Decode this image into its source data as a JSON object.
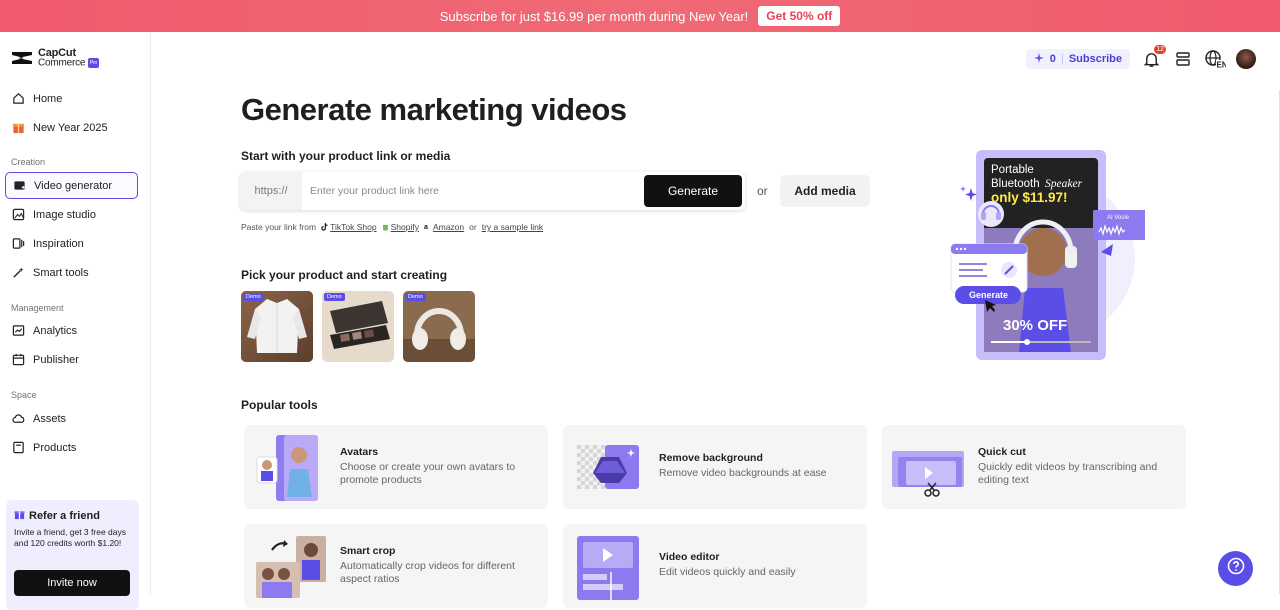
{
  "banner": {
    "text": "Subscribe for just $16.99 per month during New Year!",
    "button": "Get 50% off"
  },
  "brand": {
    "line1": "CapCut",
    "line2": "Commerce",
    "badge": "Pro"
  },
  "sidebar": {
    "top_items": [
      {
        "label": "Home",
        "icon": "home-icon"
      },
      {
        "label": "New Year 2025",
        "icon": "gift-icon"
      }
    ],
    "sections": [
      {
        "label": "Creation",
        "items": [
          {
            "label": "Video generator",
            "icon": "video-generator-icon",
            "active": true
          },
          {
            "label": "Image studio",
            "icon": "image-studio-icon"
          },
          {
            "label": "Inspiration",
            "icon": "inspiration-icon"
          },
          {
            "label": "Smart tools",
            "icon": "magic-wand-icon"
          }
        ]
      },
      {
        "label": "Management",
        "items": [
          {
            "label": "Analytics",
            "icon": "analytics-icon"
          },
          {
            "label": "Publisher",
            "icon": "calendar-icon"
          }
        ]
      },
      {
        "label": "Space",
        "items": [
          {
            "label": "Assets",
            "icon": "cloud-icon"
          },
          {
            "label": "Products",
            "icon": "product-icon"
          }
        ]
      }
    ],
    "refer": {
      "title": "Refer a friend",
      "desc": "Invite a friend, get 3 free days and 120 credits worth $1.20!",
      "button": "Invite now"
    }
  },
  "topbar": {
    "credits": "0",
    "subscribe": "Subscribe",
    "notifications": "12",
    "lang": "EN"
  },
  "main": {
    "title": "Generate marketing videos",
    "link_section_title": "Start with your product link or media",
    "prefix": "https://",
    "placeholder": "Enter your product link here",
    "generate": "Generate",
    "or": "or",
    "add_media": "Add media",
    "paste_label": "Paste your link from",
    "sources": [
      "TikTok Shop",
      "Shopify",
      "Amazon"
    ],
    "or_small": "or",
    "sample": "try a sample link",
    "pick_title": "Pick your product and start creating",
    "demo_label": "Demo",
    "popular_title": "Popular tools",
    "tools": [
      {
        "name": "Avatars",
        "desc": "Choose or create your own avatars to promote products"
      },
      {
        "name": "Remove background",
        "desc": "Remove video backgrounds at ease"
      },
      {
        "name": "Quick cut",
        "desc": "Quickly edit videos by transcribing and editing text"
      },
      {
        "name": "Smart crop",
        "desc": "Automatically crop videos for different aspect ratios"
      },
      {
        "name": "Video editor",
        "desc": "Edit videos quickly and easily"
      }
    ]
  },
  "hero": {
    "line1": "Portable",
    "line2a": "Bluetooth",
    "line2b": "Speaker",
    "price": "only $11.97!",
    "discount": "30% OFF",
    "ai_voice": "AI Vocie",
    "generate": "Generate"
  },
  "colors": {
    "accent": "#5b4ee6",
    "banner": "#f1596e"
  }
}
